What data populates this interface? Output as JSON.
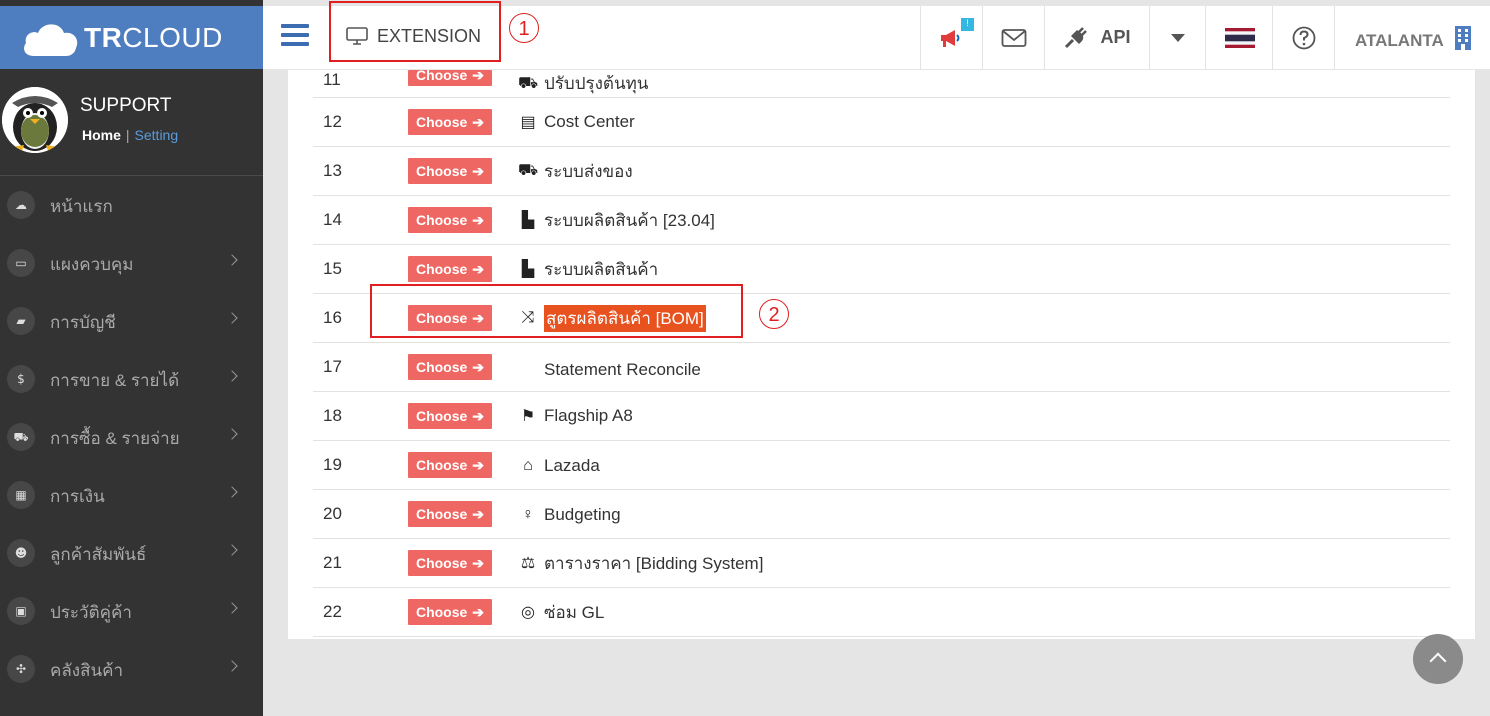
{
  "brand": {
    "name_bold": "TR",
    "name_rest": "CLOUD"
  },
  "profile": {
    "name": "SUPPORT",
    "home_link": "Home",
    "separator": "|",
    "setting_link": "Setting"
  },
  "sidebar": {
    "items": [
      {
        "label": "หน้าแรก",
        "icon": "cloud-icon",
        "has_submenu": false
      },
      {
        "label": "แผงควบคุม",
        "icon": "monitor-icon",
        "has_submenu": true
      },
      {
        "label": "การบัญชี",
        "icon": "book-icon",
        "has_submenu": true
      },
      {
        "label": "การขาย & รายได้",
        "icon": "dollar-icon",
        "has_submenu": true
      },
      {
        "label": "การซื้อ & รายจ่าย",
        "icon": "cart-icon",
        "has_submenu": true
      },
      {
        "label": "การเงิน",
        "icon": "calendar-icon",
        "has_submenu": true
      },
      {
        "label": "ลูกค้าสัมพันธ์",
        "icon": "users-icon",
        "has_submenu": true
      },
      {
        "label": "ประวัติคู่ค้า",
        "icon": "address-book-icon",
        "has_submenu": true
      },
      {
        "label": "คลังสินค้า",
        "icon": "cubes-icon",
        "has_submenu": true
      }
    ]
  },
  "topbar": {
    "extension_label": "EXTENSION",
    "notification_badge": "!",
    "api_label": "API",
    "user_label": "ATALANTA"
  },
  "extensions": {
    "choose_label": "Choose",
    "rows": [
      {
        "num": "11",
        "name": "ปรับปรุงต้นทุน",
        "icon": "truck-icon",
        "partial": true
      },
      {
        "num": "12",
        "name": "Cost Center",
        "icon": "building-icon"
      },
      {
        "num": "13",
        "name": "ระบบส่งของ",
        "icon": "truck-icon"
      },
      {
        "num": "14",
        "name": "ระบบผลิตสินค้า [23.04]",
        "icon": "industry-icon"
      },
      {
        "num": "15",
        "name": "ระบบผลิตสินค้า",
        "icon": "industry-icon"
      },
      {
        "num": "16",
        "name": "สูตรผลิตสินค้า [BOM]",
        "icon": "shuffle-icon",
        "highlighted": true
      },
      {
        "num": "17",
        "name": "Statement Reconcile",
        "icon": "code-icon"
      },
      {
        "num": "18",
        "name": "Flagship A8",
        "icon": "flag-icon"
      },
      {
        "num": "19",
        "name": "Lazada",
        "icon": "shopping-bag-icon"
      },
      {
        "num": "20",
        "name": "Budgeting",
        "icon": "lightbulb-icon"
      },
      {
        "num": "21",
        "name": "ตารางราคา [Bidding System]",
        "icon": "balance-scale-icon"
      },
      {
        "num": "22",
        "name": "ซ่อม GL",
        "icon": "life-ring-icon"
      }
    ]
  },
  "annotations": {
    "step1": "1",
    "step2": "2"
  },
  "colors": {
    "brand_blue": "#4e7ec0",
    "choose_red": "#ef6762",
    "highlight": "#e8521f",
    "annotation_red": "#e02020"
  }
}
